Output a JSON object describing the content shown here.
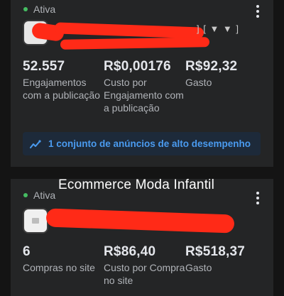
{
  "cards": [
    {
      "status": "Ativa",
      "status_color": "#45bd62",
      "metrics": [
        {
          "value": "52.557",
          "label": "Engajamentos com a publicação"
        },
        {
          "value": "R$0,00176",
          "label": "Custo por Engajamento com a publicação"
        },
        {
          "value": "R$92,32",
          "label": "Gasto"
        }
      ],
      "insight": {
        "icon": "trend-up-icon",
        "text": "1 conjunto de anúncios de alto desempenho",
        "color": "#4a9bf0"
      },
      "name_tail": "] [ ▼ ▼ ]"
    },
    {
      "status": "Ativa",
      "status_color": "#45bd62",
      "metrics": [
        {
          "value": "6",
          "label": "Compras no site"
        },
        {
          "value": "R$86,40",
          "label": "Custo por Compra no site"
        },
        {
          "value": "R$518,37",
          "label": "Gasto"
        }
      ]
    }
  ],
  "caption": "Ecommerce Moda Infantil",
  "redaction_color": "#ff2a17"
}
